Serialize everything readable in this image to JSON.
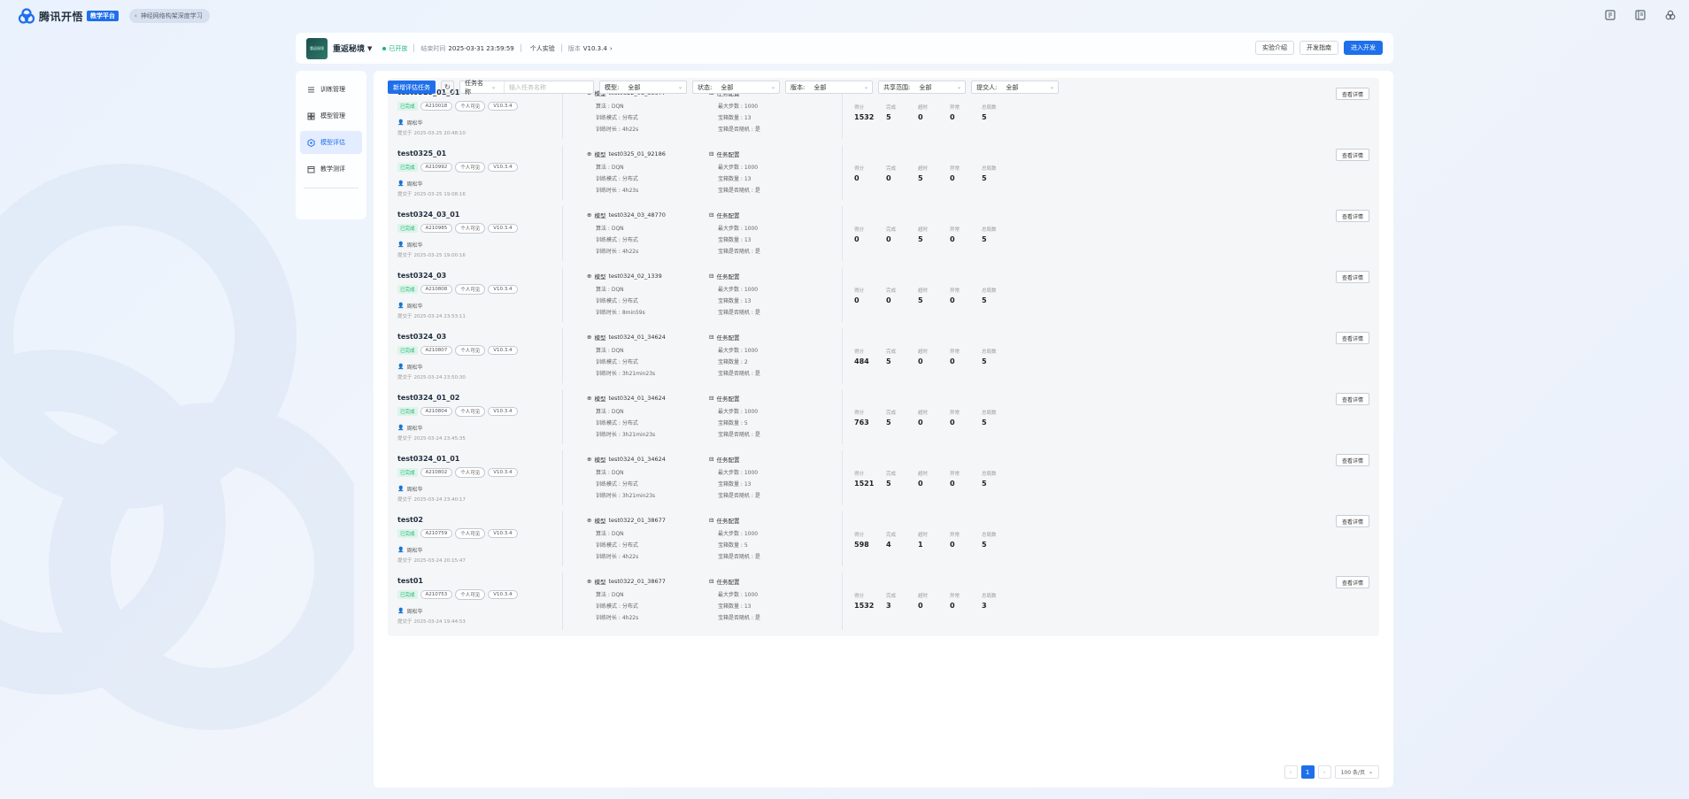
{
  "topbar": {
    "logo_text": "腾讯开悟",
    "logo_badge": "教学平台",
    "back_label": "神经网络构架深度学习"
  },
  "header": {
    "project_name": "重返秘境",
    "project_thumb": "重返秘境",
    "status": "已开放",
    "end_time_label": "结束时间",
    "end_time": "2025-03-31 23:59:59",
    "experiment_type": "个人实验",
    "version_label": "版本",
    "version": "V10.3.4",
    "btn_intro": "实验介绍",
    "btn_guide": "开发指南",
    "btn_enter": "进入开发"
  },
  "sidebar": {
    "items": [
      {
        "label": "训练管理"
      },
      {
        "label": "模型管理"
      },
      {
        "label": "模型评估"
      },
      {
        "label": "教学测评"
      }
    ]
  },
  "toolbar": {
    "new_button": "新增评估任务",
    "name_filter_label": "任务名称",
    "name_placeholder": "输入任务名称",
    "model_label": "模型:",
    "model_value": "全部",
    "state_label": "状态:",
    "state_value": "全部",
    "version_label": "版本:",
    "version_value": "全部",
    "share_label": "共享范围:",
    "share_value": "全部",
    "submitter_label": "提交人:",
    "submitter_value": "全部"
  },
  "labels": {
    "model_prefix": "模型",
    "algo": "算法 : DQN",
    "mode": "训练模式 : 分布式",
    "duration_prefix": "训练时长 : ",
    "task_config": "任务配置",
    "max_steps": "最大步数 : 1000",
    "treasure_prefix": "宝箱数量 : ",
    "random": "宝箱是否随机 : 是",
    "owner": "周松华",
    "submit_prefix": "提交于",
    "stat_score": "得分",
    "stat_done": "完成",
    "stat_timeout": "超时",
    "stat_error": "异常",
    "stat_total": "总局数",
    "detail_button": "查看详情"
  },
  "rows": [
    {
      "title": "test0325_01_01",
      "status": "已完成",
      "id": "A210018",
      "scope": "个人可见",
      "version": "V10.3.4",
      "submit_time": "2025-03-25 20:48:10",
      "model": "test0322_01_38677",
      "duration": "4h22s",
      "treasure": "13",
      "score": "1532",
      "done": "5",
      "timeout": "0",
      "error": "0",
      "total": "5"
    },
    {
      "title": "test0325_01",
      "status": "已完成",
      "id": "A210992",
      "scope": "个人可见",
      "version": "V10.3.4",
      "submit_time": "2025-03-25 19:08:16",
      "model": "test0325_01_92186",
      "duration": "4h23s",
      "treasure": "13",
      "score": "0",
      "done": "0",
      "timeout": "5",
      "error": "0",
      "total": "5"
    },
    {
      "title": "test0324_03_01",
      "status": "已完成",
      "id": "A210985",
      "scope": "个人可见",
      "version": "V10.3.4",
      "submit_time": "2025-03-25 19:00:16",
      "model": "test0324_03_48770",
      "duration": "4h22s",
      "treasure": "13",
      "score": "0",
      "done": "0",
      "timeout": "5",
      "error": "0",
      "total": "5"
    },
    {
      "title": "test0324_03",
      "status": "已完成",
      "id": "A210808",
      "scope": "个人可见",
      "version": "V10.3.4",
      "submit_time": "2025-03-24 23:53:11",
      "model": "test0324_02_1339",
      "duration": "8min59s",
      "treasure": "13",
      "score": "0",
      "done": "0",
      "timeout": "5",
      "error": "0",
      "total": "5"
    },
    {
      "title": "test0324_03",
      "status": "已完成",
      "id": "A210807",
      "scope": "个人可见",
      "version": "V10.3.4",
      "submit_time": "2025-03-24 23:50:30",
      "model": "test0324_01_34624",
      "duration": "3h21min23s",
      "treasure": "2",
      "score": "484",
      "done": "5",
      "timeout": "0",
      "error": "0",
      "total": "5"
    },
    {
      "title": "test0324_01_02",
      "status": "已完成",
      "id": "A210804",
      "scope": "个人可见",
      "version": "V10.3.4",
      "submit_time": "2025-03-24 23:45:35",
      "model": "test0324_01_34624",
      "duration": "3h21min23s",
      "treasure": "5",
      "score": "763",
      "done": "5",
      "timeout": "0",
      "error": "0",
      "total": "5"
    },
    {
      "title": "test0324_01_01",
      "status": "已完成",
      "id": "A210802",
      "scope": "个人可见",
      "version": "V10.3.4",
      "submit_time": "2025-03-24 23:40:17",
      "model": "test0324_01_34624",
      "duration": "3h21min23s",
      "treasure": "13",
      "score": "1521",
      "done": "5",
      "timeout": "0",
      "error": "0",
      "total": "5"
    },
    {
      "title": "test02",
      "status": "已完成",
      "id": "A210759",
      "scope": "个人可见",
      "version": "V10.3.4",
      "submit_time": "2025-03-24 20:15:47",
      "model": "test0322_01_38677",
      "duration": "4h22s",
      "treasure": "5",
      "score": "598",
      "done": "4",
      "timeout": "1",
      "error": "0",
      "total": "5"
    },
    {
      "title": "test01",
      "status": "已完成",
      "id": "A210753",
      "scope": "个人可见",
      "version": "V10.3.4",
      "submit_time": "2025-03-24 19:44:53",
      "model": "test0322_01_38677",
      "duration": "4h22s",
      "treasure": "13",
      "score": "1532",
      "done": "3",
      "timeout": "0",
      "error": "0",
      "total": "3"
    }
  ],
  "pager": {
    "current": "1",
    "page_size": "100 条/页"
  }
}
